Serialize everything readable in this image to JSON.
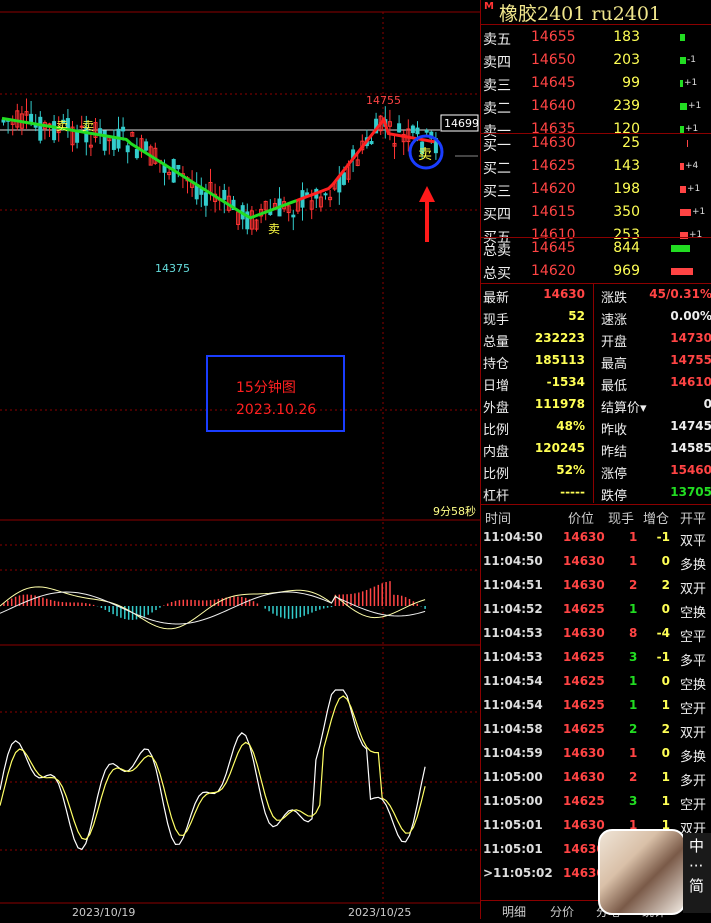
{
  "title": {
    "badge": "M",
    "text": "橡胶2401  ru2401"
  },
  "price_labels": {
    "high": "14755",
    "low": "14375",
    "current": "14699"
  },
  "annotation": {
    "line1": "15分钟图",
    "line2": "2023.10.26",
    "sell_marker": "卖"
  },
  "countdown": "9分58秒",
  "x_axis": [
    "2023/10/19",
    "2023/10/25"
  ],
  "asks": [
    {
      "label": "卖五",
      "price": "14655",
      "vol": "183",
      "chg": "",
      "bar": 0.35
    },
    {
      "label": "卖四",
      "price": "14650",
      "vol": "203",
      "chg": "-1",
      "bar": 0.4
    },
    {
      "label": "卖三",
      "price": "14645",
      "vol": "99",
      "chg": "+1",
      "bar": 0.2
    },
    {
      "label": "卖二",
      "price": "14640",
      "vol": "239",
      "chg": "+1",
      "bar": 0.48
    },
    {
      "label": "卖一",
      "price": "14635",
      "vol": "120",
      "chg": "+1",
      "bar": 0.24
    }
  ],
  "bids": [
    {
      "label": "买一",
      "price": "14630",
      "vol": "25",
      "chg": "",
      "bar": 0.05
    },
    {
      "label": "买二",
      "price": "14625",
      "vol": "143",
      "chg": "+4",
      "bar": 0.29
    },
    {
      "label": "买三",
      "price": "14620",
      "vol": "198",
      "chg": "+1",
      "bar": 0.4
    },
    {
      "label": "买四",
      "price": "14615",
      "vol": "350",
      "chg": "+1",
      "bar": 0.7
    },
    {
      "label": "买五",
      "price": "14610",
      "vol": "253",
      "chg": "+1",
      "bar": 0.5
    }
  ],
  "totals": [
    {
      "label": "总卖",
      "price": "14645",
      "vol": "844",
      "bar": 0.8
    },
    {
      "label": "总买",
      "price": "14620",
      "vol": "969",
      "bar": 0.9
    }
  ],
  "stats": [
    {
      "l1": "最新",
      "v1": "14630",
      "l2": "涨跌",
      "v2": "45/0.31%",
      "c1": "#ff4444",
      "c2": "#ff4444"
    },
    {
      "l1": "现手",
      "v1": "52",
      "l2": "速涨",
      "v2": "0.00%",
      "c1": "#ffff55",
      "c2": "#eeeeee"
    },
    {
      "l1": "总量",
      "v1": "232223",
      "l2": "开盘",
      "v2": "14730",
      "c1": "#ffff55",
      "c2": "#ff4444"
    },
    {
      "l1": "持仓",
      "v1": "185113",
      "l2": "最高",
      "v2": "14755",
      "c1": "#ffff55",
      "c2": "#ff4444"
    },
    {
      "l1": "日增",
      "v1": "-1534",
      "l2": "最低",
      "v2": "14610",
      "c1": "#ffff55",
      "c2": "#ff4444"
    },
    {
      "l1": "外盘",
      "v1": "111978",
      "l2": "结算价▾",
      "v2": "0",
      "c1": "#ffff55",
      "c2": "#eeeeee"
    },
    {
      "l1": "比例",
      "v1": "48%",
      "l2": "昨收",
      "v2": "14745",
      "c1": "#ffff55",
      "c2": "#eeeeee"
    },
    {
      "l1": "内盘",
      "v1": "120245",
      "l2": "昨结",
      "v2": "14585",
      "c1": "#ffff55",
      "c2": "#eeeeee"
    },
    {
      "l1": "比例",
      "v1": "52%",
      "l2": "涨停",
      "v2": "15460",
      "c1": "#ffff55",
      "c2": "#ff4444"
    },
    {
      "l1": "杠杆",
      "v1": "-----",
      "l2": "跌停",
      "v2": "13705",
      "c1": "#ffff55",
      "c2": "#22dd22"
    }
  ],
  "tick_headers": [
    "时间",
    "价位",
    "现手",
    "增仓",
    "开平"
  ],
  "ticks": [
    {
      "time": "11:04:50",
      "price": "14630",
      "vol": "1",
      "oi": "-1",
      "type": "双平",
      "pc": "#ff4444",
      "vc": "#ff4444"
    },
    {
      "time": "11:04:50",
      "price": "14630",
      "vol": "1",
      "oi": "0",
      "type": "多换",
      "pc": "#ff4444",
      "vc": "#ff4444"
    },
    {
      "time": "11:04:51",
      "price": "14630",
      "vol": "2",
      "oi": "2",
      "type": "双开",
      "pc": "#ff4444",
      "vc": "#ff4444"
    },
    {
      "time": "11:04:52",
      "price": "14625",
      "vol": "1",
      "oi": "0",
      "type": "空换",
      "pc": "#ff4444",
      "vc": "#22dd22"
    },
    {
      "time": "11:04:53",
      "price": "14630",
      "vol": "8",
      "oi": "-4",
      "type": "空平",
      "pc": "#ff4444",
      "vc": "#ff4444"
    },
    {
      "time": "11:04:53",
      "price": "14625",
      "vol": "3",
      "oi": "-1",
      "type": "多平",
      "pc": "#ff4444",
      "vc": "#22dd22"
    },
    {
      "time": "11:04:54",
      "price": "14625",
      "vol": "1",
      "oi": "0",
      "type": "空换",
      "pc": "#ff4444",
      "vc": "#22dd22"
    },
    {
      "time": "11:04:54",
      "price": "14625",
      "vol": "1",
      "oi": "1",
      "type": "空开",
      "pc": "#ff4444",
      "vc": "#22dd22"
    },
    {
      "time": "11:04:58",
      "price": "14625",
      "vol": "2",
      "oi": "2",
      "type": "双开",
      "pc": "#ff4444",
      "vc": "#22dd22"
    },
    {
      "time": "11:04:59",
      "price": "14630",
      "vol": "1",
      "oi": "0",
      "type": "多换",
      "pc": "#ff4444",
      "vc": "#ff4444"
    },
    {
      "time": "11:05:00",
      "price": "14630",
      "vol": "2",
      "oi": "1",
      "type": "多开",
      "pc": "#ff4444",
      "vc": "#ff4444"
    },
    {
      "time": "11:05:00",
      "price": "14625",
      "vol": "3",
      "oi": "1",
      "type": "空开",
      "pc": "#ff4444",
      "vc": "#22dd22"
    },
    {
      "time": "11:05:01",
      "price": "14630",
      "vol": "1",
      "oi": "1",
      "type": "双开",
      "pc": "#ff4444",
      "vc": "#ff4444"
    },
    {
      "time": "11:05:01",
      "price": "14630",
      "vol": "",
      "oi": "",
      "type": "",
      "pc": "#ff4444",
      "vc": "#ff4444"
    },
    {
      "time": ">11:05:02",
      "price": "14630",
      "vol": "",
      "oi": "",
      "type": "",
      "pc": "#ff4444",
      "vc": "#ff4444"
    }
  ],
  "tabs": [
    "明细",
    "分价",
    "分笔",
    "统计"
  ],
  "float_chars": [
    "中",
    "简"
  ],
  "colors": {
    "up": "#ff4444",
    "down": "#22dd22",
    "neutral": "#ffff55",
    "border": "#8b0000",
    "ma_up": "#ff2020",
    "ma_down": "#22dd22",
    "candle_down": "#33cccc"
  }
}
